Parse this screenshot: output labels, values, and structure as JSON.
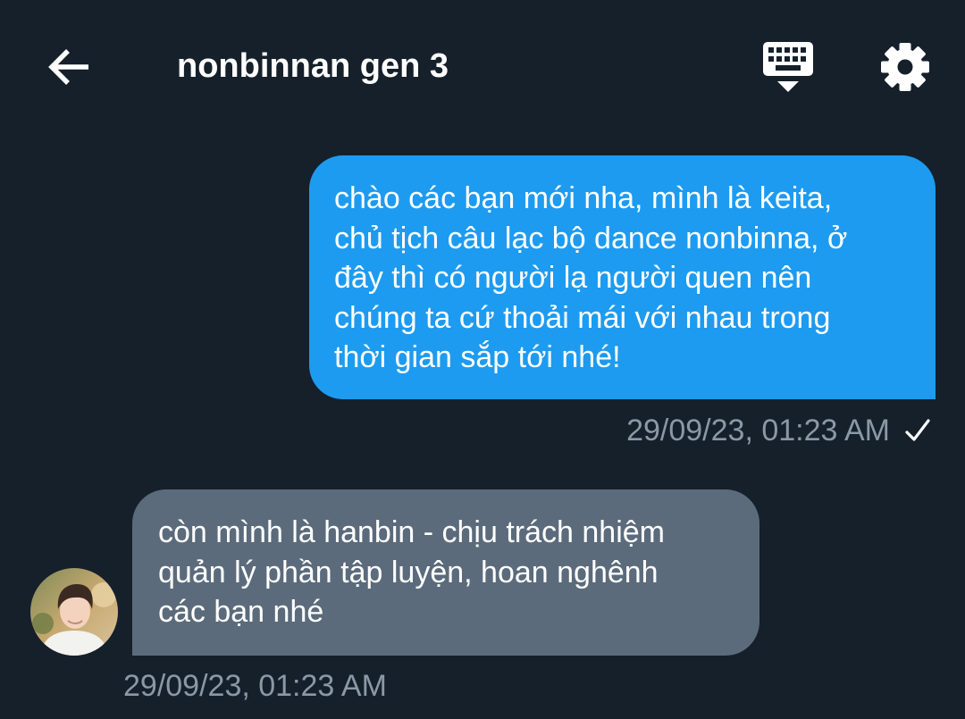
{
  "header": {
    "title": "nonbinnan gen 3",
    "back_icon": "arrow-left-icon",
    "keyboard_icon": "keyboard-icon",
    "settings_icon": "gear-icon"
  },
  "messages": [
    {
      "direction": "outgoing",
      "lines": [
        "chào các bạn mới nha, mình là keita,",
        "chủ tịch câu lạc bộ dance nonbinna, ở",
        "đây thì có người lạ người quen nên",
        "chúng ta cứ thoải mái với nhau trong",
        "thời gian sắp tới nhé!"
      ],
      "timestamp": "29/09/23, 01:23 AM",
      "status_icon": "check-icon"
    },
    {
      "direction": "incoming",
      "lines": [
        "còn mình là hanbin - chịu trách nhiệm",
        "quản lý phần tập luyện, hoan nghênh",
        "các bạn nhé"
      ],
      "timestamp": "29/09/23, 01:23 AM",
      "avatar_icon": "avatar"
    }
  ],
  "colors": {
    "background": "#15202b",
    "outgoing_bubble": "#1d9bf0",
    "incoming_bubble": "#5b6b7b",
    "timestamp": "#8b98a5",
    "text": "#ffffff"
  }
}
